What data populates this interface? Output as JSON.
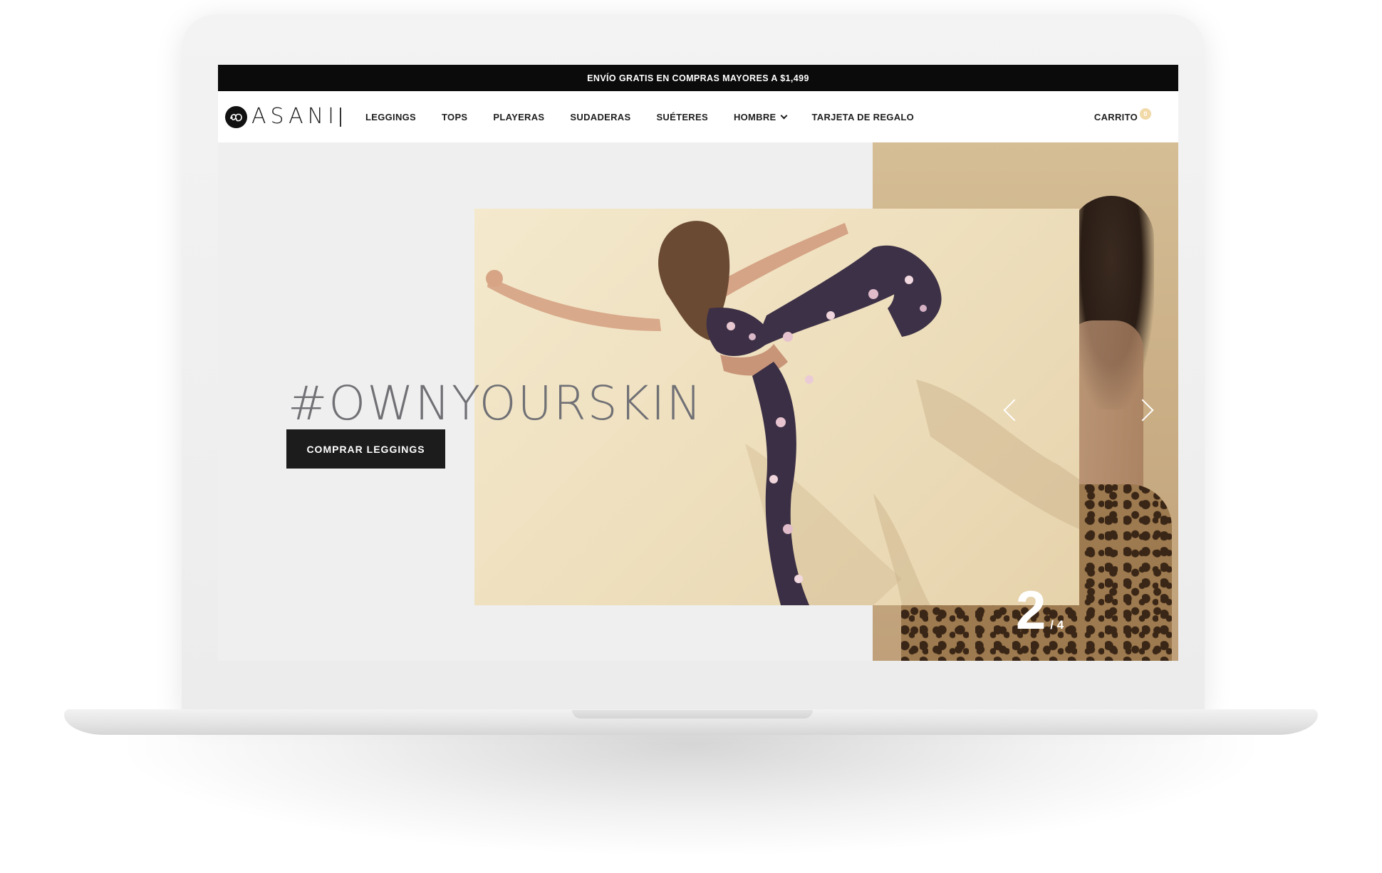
{
  "announcement": {
    "text": "ENVÍO GRATIS EN COMPRAS MAYORES A $1,499"
  },
  "brand": {
    "name": "ASANI"
  },
  "nav": {
    "items": [
      {
        "label": "LEGGINGS"
      },
      {
        "label": "TOPS"
      },
      {
        "label": "PLAYERAS"
      },
      {
        "label": "SUDADERAS"
      },
      {
        "label": "SUÉTERES"
      },
      {
        "label": "HOMBRE",
        "has_dropdown": true
      },
      {
        "label": "TARJETA DE REGALO"
      }
    ],
    "cart_label": "CARRITO",
    "cart_count": "0"
  },
  "hero": {
    "heading": "#OWNYOURSKIN",
    "cta_label": "COMPRAR LEGGINGS",
    "slide_current": "2",
    "slide_total": "/ 4",
    "prev_icon": "chevron-left-icon",
    "next_icon": "chevron-right-icon"
  },
  "colors": {
    "announcement_bg": "#0b0b0b",
    "cta_bg": "#1c1c1c",
    "hero_bg": "#efefef",
    "slide_bg": "#f0e3c4",
    "cart_badge": "#f1d9a8"
  }
}
